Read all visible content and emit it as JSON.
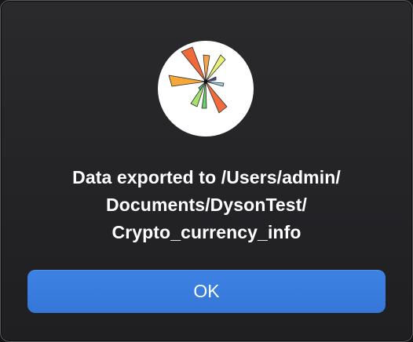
{
  "dialog": {
    "icon": "pinwheel-chart-app-icon",
    "message_lines": [
      "Data exported to /Users/admin/",
      "Documents/DysonTest/",
      "Crypto_currency_info"
    ],
    "ok_label": "OK"
  },
  "colors": {
    "dialog_background": "#252528",
    "button_background": "#3a7ee0",
    "text": "#ffffff"
  }
}
